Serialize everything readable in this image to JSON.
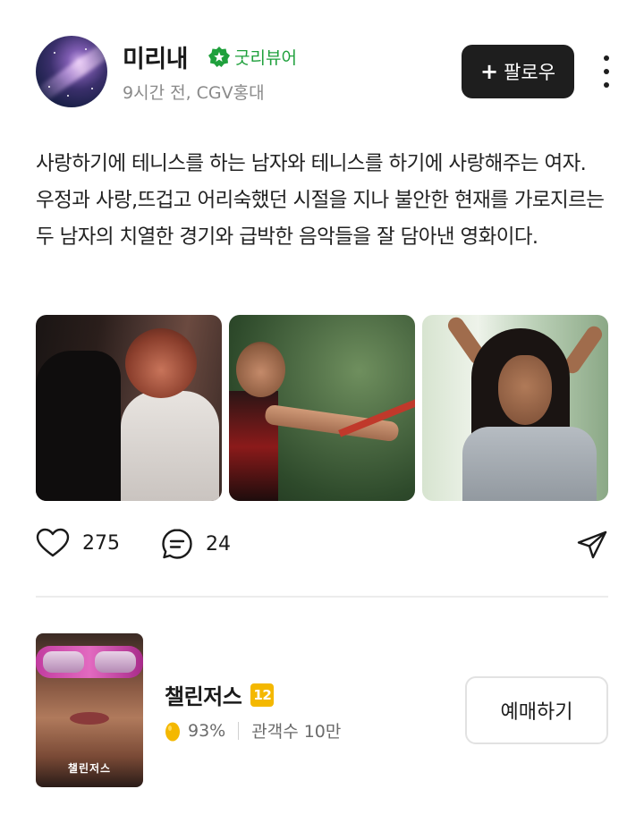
{
  "profile": {
    "username": "미리내",
    "badge_label": "굿리뷰어",
    "meta": "9시간 전, CGV홍대",
    "follow_label": "팔로우",
    "follow_icon": "+"
  },
  "post": {
    "text": "사랑하기에 테니스를 하는 남자와 테니스를 하기에 사랑해주는 여자. 우정과 사랑,뜨겁고 어리숙했던 시절을 지나 불안한 현재를 가로지르는 두 남자의 치열한 경기와 급박한 음악들을 잘 담아낸 영화이다.",
    "images": [
      "movie-still-1",
      "movie-still-2",
      "movie-still-3"
    ]
  },
  "actions": {
    "likes": "275",
    "comments": "24"
  },
  "movie": {
    "title": "챌린저스",
    "age_rating": "12",
    "score": "93%",
    "audience": "관객수 10만",
    "book_label": "예매하기",
    "poster_title": "챌린저스"
  },
  "colors": {
    "badge_green": "#1fa03c",
    "follow_bg": "#1e1e1e",
    "rating_yellow": "#f4b800"
  }
}
